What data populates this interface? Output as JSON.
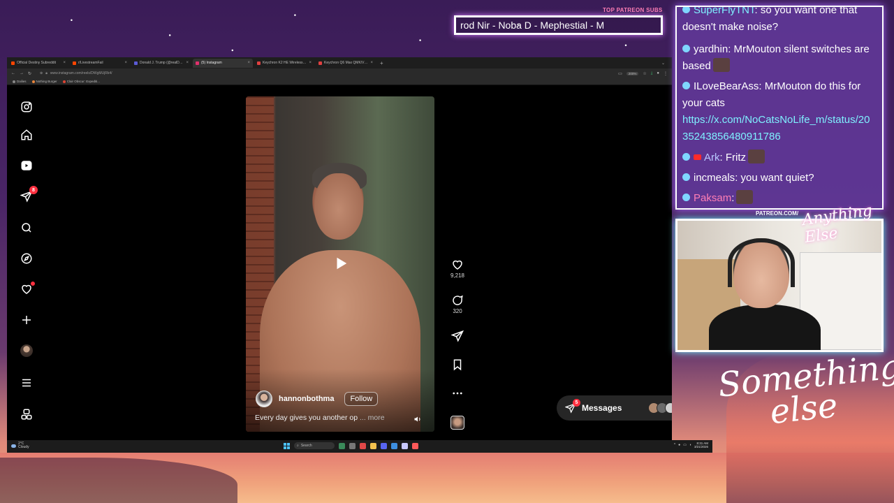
{
  "overlay": {
    "patreon_title": "TOP PATREON SUBS",
    "ticker_text": "rod Nir - Noba D - Mephestial - M",
    "cam_patreon": "PATREON.COM/",
    "cam_logo": "Anything Else",
    "brand_text_line1": "Something",
    "brand_text_line2": "else"
  },
  "browser": {
    "tabs": [
      {
        "label": "Official Destiny Subreddit",
        "color": "#ff4500",
        "active": false
      },
      {
        "label": "r/LivestreamFail",
        "color": "#ff4500",
        "active": false
      },
      {
        "label": "Donald J. Trump (@realDonald",
        "color": "#5b5bd6",
        "active": false
      },
      {
        "label": "(5) Instagram",
        "color": "#e1306c",
        "active": true
      },
      {
        "label": "Keychron K2 HE Wireless Magn",
        "color": "#e04040",
        "active": false
      },
      {
        "label": "Keychron Q6 Max QMK/VIA W",
        "color": "#e04040",
        "active": false
      }
    ],
    "new_tab": "+",
    "url": "www.instagram.com/reels/DWgMUjRk4/",
    "zoom": "200%",
    "bookmarks": [
      {
        "label": "Dailies",
        "color": "#888"
      },
      {
        "label": "Nothing Burger",
        "color": "#e8843a"
      },
      {
        "label": "Clair Obscur: Expediti...",
        "color": "#d43"
      }
    ]
  },
  "instagram": {
    "sidebar": {
      "notifications_count": "8"
    },
    "reel": {
      "author": "hannonbothma",
      "follow_label": "Follow",
      "caption": "Every day gives you another op",
      "more_label": "... more",
      "likes": "9,218",
      "comments": "320"
    },
    "messages": {
      "label": "Messages",
      "badge": "5",
      "more": "···"
    }
  },
  "taskbar": {
    "weather_temp": "2°C",
    "weather_desc": "Cloudy",
    "search_label": "Search",
    "time": "8:31 AM",
    "date": "3/21/2026"
  },
  "chat": {
    "messages": [
      {
        "user": "SuperFlyTNT",
        "text": "so you want one that doesn't make noise?",
        "user_color": "u-cyan"
      },
      {
        "user": "yardhin",
        "text": "MrMouton silent switches are based",
        "user_color": ""
      },
      {
        "user": "ILoveBearAss",
        "text": "MrMouton do this for your cats",
        "user_color": ""
      },
      {
        "link": "https://x.com/NoCatsNoLife_m/status/2035243856480911786"
      },
      {
        "user": "Ark",
        "text": "Fritz",
        "user_color": "u-lav"
      },
      {
        "user": "incmeals",
        "text": "you want quiet?",
        "user_color": ""
      },
      {
        "user": "Paksam",
        "text": "",
        "user_color": "u-pink"
      }
    ]
  }
}
